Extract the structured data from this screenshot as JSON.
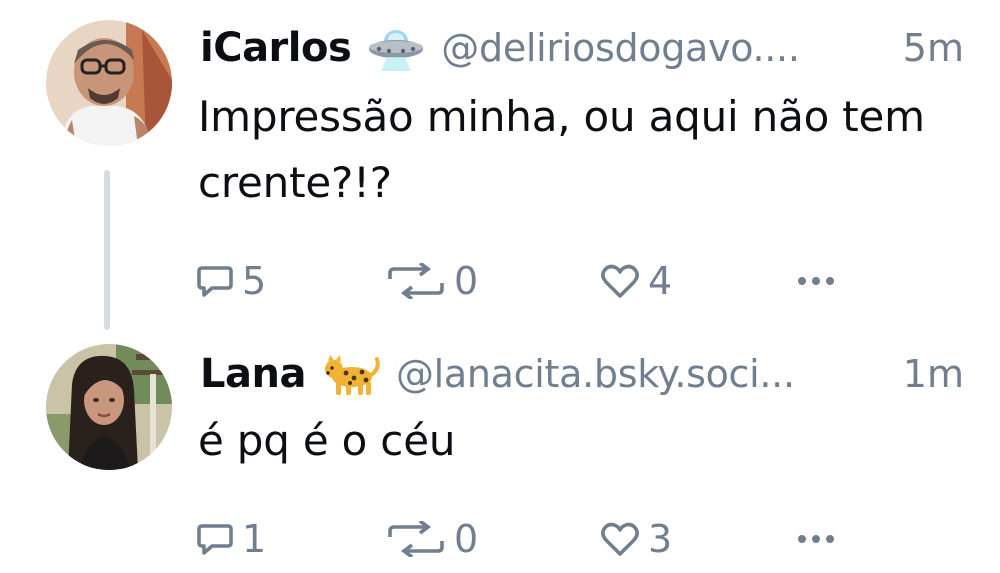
{
  "posts": [
    {
      "display_name": "iCarlos",
      "name_emoji": "flying-saucer-emoji",
      "handle": "@deliriosdogavo....",
      "timestamp": "5m",
      "text": "Impressão minha, ou aqui não tem crente?!?",
      "reply_count": "5",
      "repost_count": "0",
      "like_count": "4",
      "avatar": "user-avatar-photo"
    },
    {
      "display_name": "Lana",
      "name_emoji": "leopard-emoji",
      "handle": "@lanacita.bsky.soci...",
      "timestamp": "1m",
      "text": "é pq é o céu",
      "reply_count": "1",
      "repost_count": "0",
      "like_count": "3",
      "avatar": "user-avatar-photo"
    }
  ],
  "icons": {
    "reply": "reply-bubble-icon",
    "repost": "repost-arrows-icon",
    "like": "heart-icon",
    "more": "more-dots-icon"
  },
  "colors": {
    "text": "#0b0f14",
    "muted": "#6f7f8f",
    "thread_line": "#d4dbe2",
    "background": "#ffffff"
  }
}
